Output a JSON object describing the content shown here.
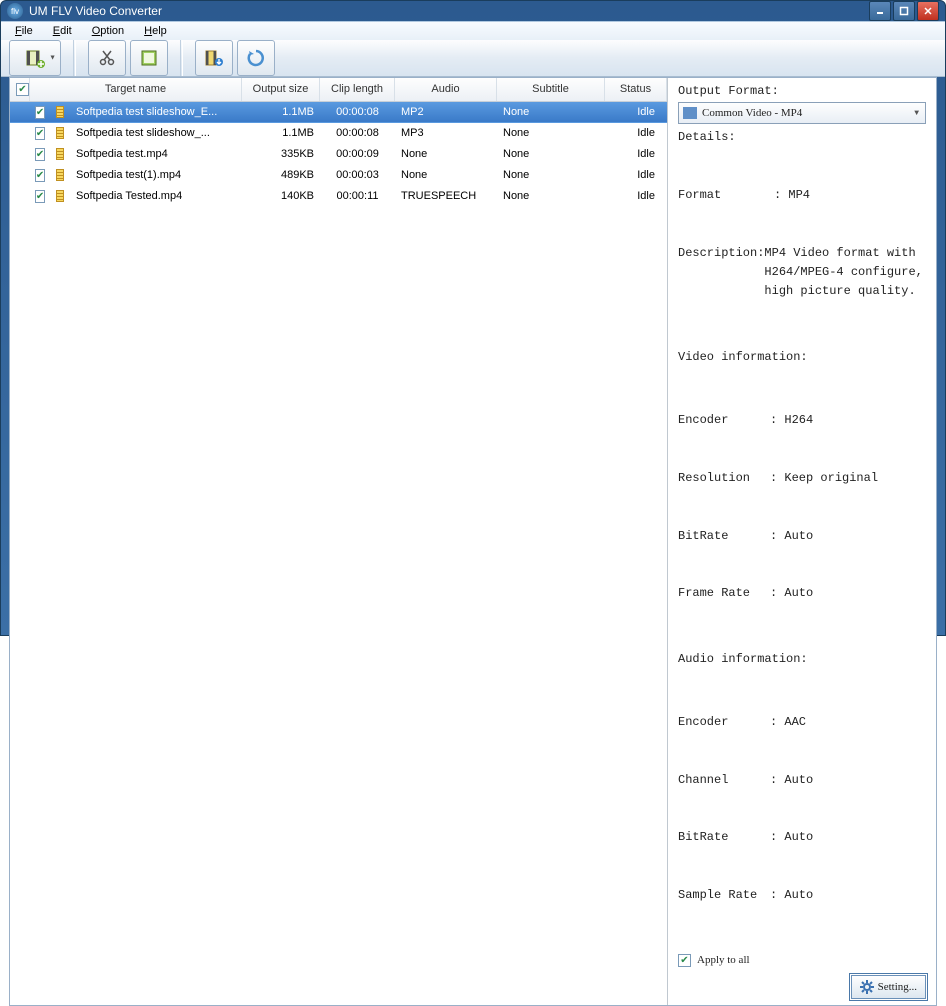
{
  "window": {
    "title": "UM FLV Video Converter"
  },
  "menu": [
    "File",
    "Edit",
    "Option",
    "Help"
  ],
  "columns": {
    "target_name": "Target name",
    "output_size": "Output size",
    "clip_length": "Clip length",
    "audio": "Audio",
    "subtitle": "Subtitle",
    "status": "Status"
  },
  "rows": [
    {
      "checked": true,
      "name": "Softpedia test slideshow_E...",
      "size": "1.1MB",
      "clip": "00:00:08",
      "audio": "MP2",
      "subtitle": "None",
      "status": "Idle",
      "selected": true
    },
    {
      "checked": true,
      "name": "Softpedia test slideshow_...",
      "size": "1.1MB",
      "clip": "00:00:08",
      "audio": "MP3",
      "subtitle": "None",
      "status": "Idle",
      "selected": false
    },
    {
      "checked": true,
      "name": "Softpedia test.mp4",
      "size": "335KB",
      "clip": "00:00:09",
      "audio": "None",
      "subtitle": "None",
      "status": "Idle",
      "selected": false
    },
    {
      "checked": true,
      "name": "Softpedia test(1).mp4",
      "size": "489KB",
      "clip": "00:00:03",
      "audio": "None",
      "subtitle": "None",
      "status": "Idle",
      "selected": false
    },
    {
      "checked": true,
      "name": "Softpedia Tested.mp4",
      "size": "140KB",
      "clip": "00:00:11",
      "audio": "TRUESPEECH",
      "subtitle": "None",
      "status": "Idle",
      "selected": false
    }
  ],
  "right": {
    "output_format_label": "Output Format:",
    "output_format_value": "Common Video - MP4",
    "details_label": "Details:",
    "format_k": "Format",
    "format_v": "MP4",
    "desc_k": "Description",
    "desc_v": "MP4 Video format with H264/MPEG-4 configure, high picture quality.",
    "video_info": "Video information:",
    "encoder_k": "Encoder",
    "encoder_v": "H264",
    "resolution_k": "Resolution",
    "resolution_v": "Keep original",
    "bitrate_k": "BitRate",
    "bitrate_v": "Auto",
    "framerate_k": "Frame Rate",
    "framerate_v": "Auto",
    "audio_info": "Audio information:",
    "aencoder_k": "Encoder",
    "aencoder_v": "AAC",
    "channel_k": "Channel",
    "channel_v": "Auto",
    "abitrate_k": "BitRate",
    "abitrate_v": "Auto",
    "sample_k": "Sample Rate",
    "sample_v": "Auto",
    "apply_all": "Apply to all",
    "setting": "Setting..."
  }
}
